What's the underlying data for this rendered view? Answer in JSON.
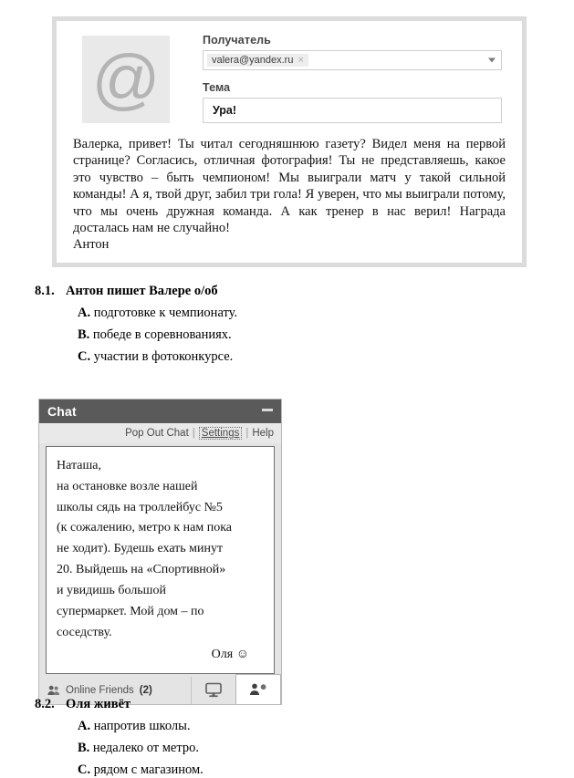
{
  "email": {
    "avatar_glyph": "@",
    "recipient_label": "Получатель",
    "recipient_value": "valera@yandex.ru",
    "chip_remove": "×",
    "subject_label": "Тема",
    "subject_value": "Ура!",
    "body": "Валерка, привет! Ты читал сегодняшнюю газету? Видел меня на первой странице? Согласись, отличная фотография! Ты не представляешь, какое это чувство – быть чемпионом! Мы выиграли матч у такой сильной команды! А я, твой друг, забил три гола! Я уверен, что мы выиграли потому, что мы очень дружная команда. А как тренер в нас верил! Награда досталась нам не случайно!",
    "signature": "Антон"
  },
  "question_81": {
    "number": "8.1.",
    "stem": "Антон пишет Валере о/об",
    "options": [
      {
        "letter": "A.",
        "text": "подготовке к чемпионату."
      },
      {
        "letter": "B.",
        "text": "победе в соревнованиях."
      },
      {
        "letter": "C.",
        "text": "участии в фотоконкурсе."
      }
    ]
  },
  "chat": {
    "title": "Chat",
    "minimize_label": "—",
    "toolbar": {
      "pop_out": "Pop Out Chat",
      "separator1": "|",
      "settings": "Settings",
      "separator2": "|",
      "help": "Help"
    },
    "message_lines": [
      "Наташа,",
      "на остановке возле нашей",
      "школы сядь на троллейбус №5",
      "(к сожалению, метро к нам пока",
      "не ходит). Будешь ехать минут",
      "20. Выйдешь на «Спортивной»",
      "и увидишь большой",
      "супермаркет. Мой дом – по",
      "соседству."
    ],
    "signature": "Оля ☺",
    "footer": {
      "friends_label": "Online Friends",
      "friends_count": "(2)"
    }
  },
  "question_82": {
    "number": "8.2.",
    "stem": "Оля живёт",
    "options": [
      {
        "letter": "A.",
        "text": "напротив школы."
      },
      {
        "letter": "B.",
        "text": "недалеко от метро."
      },
      {
        "letter": "C.",
        "text": "рядом с магазином."
      }
    ]
  },
  "colors": {
    "panel_frame": "#dcdcdc",
    "chat_titlebar": "#5a5a5a",
    "avatar_bg": "#e9e9e9",
    "avatar_glyph": "#b4b4b4",
    "toolbar_bg": "#e9e9e9"
  }
}
